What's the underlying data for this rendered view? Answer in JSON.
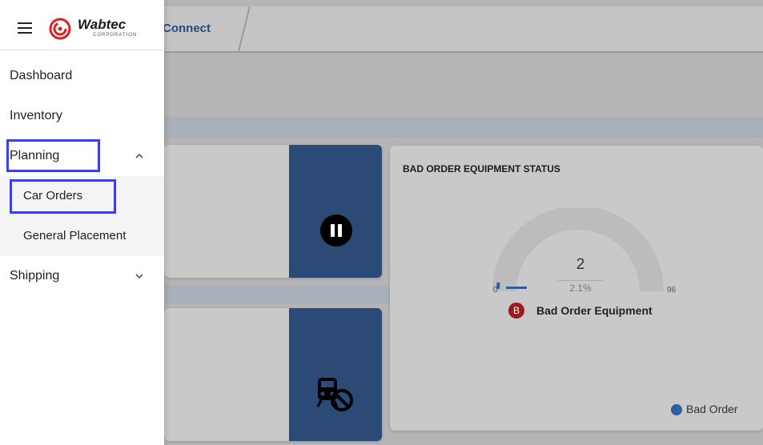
{
  "app": {
    "name": "Connect"
  },
  "logo": {
    "name": "Wabtec",
    "sub": "CORPORATION"
  },
  "nav": {
    "dashboard": "Dashboard",
    "inventory": "Inventory",
    "planning": "Planning",
    "car_orders": "Car Orders",
    "general_placement": "General Placement",
    "shipping": "Shipping"
  },
  "status_card": {
    "title": "BAD ORDER EQUIPMENT STATUS",
    "value": "2",
    "percent": "2.1%",
    "min": "0",
    "max": "96",
    "badge": "B",
    "label": "Bad Order Equipment",
    "legend": "Bad Order"
  },
  "colors": {
    "accent": "#2b4a75",
    "highlight": "#3d3fe0",
    "badge": "#9c1b1b",
    "legend": "#2d5fa3"
  }
}
